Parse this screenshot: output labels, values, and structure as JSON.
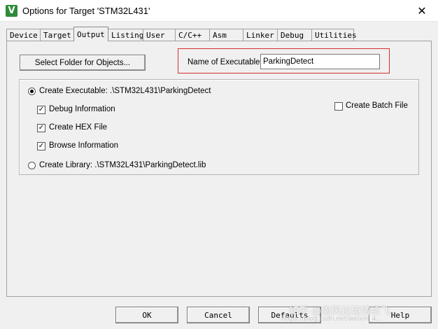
{
  "window": {
    "title": "Options for Target 'STM32L431'",
    "app_icon_glyph": "V",
    "close_glyph": "✕"
  },
  "tabs": [
    {
      "label": "Device"
    },
    {
      "label": "Target"
    },
    {
      "label": "Output"
    },
    {
      "label": "Listing"
    },
    {
      "label": "User"
    },
    {
      "label": "C/C++"
    },
    {
      "label": "Asm"
    },
    {
      "label": "Linker"
    },
    {
      "label": "Debug"
    },
    {
      "label": "Utilities"
    }
  ],
  "active_tab": "Output",
  "output": {
    "select_folder_label": "Select Folder for Objects...",
    "name_label": "Name of Executable:",
    "name_value": "ParkingDetect",
    "highlight_color": "#d32f2f",
    "create_executable_label": "Create Executable:  .\\STM32L431\\ParkingDetect",
    "create_executable_checked": true,
    "debug_info_label": "Debug Information",
    "debug_info_checked": true,
    "create_hex_label": "Create HEX File",
    "create_hex_checked": true,
    "browse_info_label": "Browse Information",
    "browse_info_checked": true,
    "create_library_label": "Create Library:  .\\STM32L431\\ParkingDetect.lib",
    "create_library_checked": false,
    "create_batch_label": "Create Batch File",
    "create_batch_checked": false,
    "check_glyph": "✓"
  },
  "footer": {
    "ok": "OK",
    "cancel": "Cancel",
    "defaults": "Defaults",
    "help": "Help"
  },
  "watermark": {
    "text": "知乎 @南风过境情终飞",
    "url_text": "https://blog.csdn.net/weixin_4..."
  }
}
